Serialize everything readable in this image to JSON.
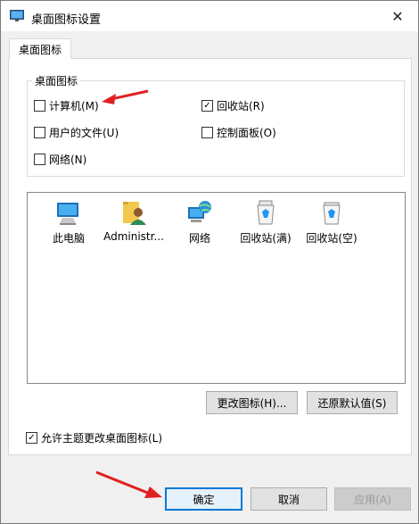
{
  "window": {
    "title": "桌面图标设置",
    "close_glyph": "✕"
  },
  "tab": {
    "label": "桌面图标"
  },
  "desktop_icons_group": {
    "legend": "桌面图标",
    "options": [
      {
        "label": "计算机(M)",
        "checked": false
      },
      {
        "label": "回收站(R)",
        "checked": true
      },
      {
        "label": "用户的文件(U)",
        "checked": false
      },
      {
        "label": "控制面板(O)",
        "checked": false
      },
      {
        "label": "网络(N)",
        "checked": false
      }
    ]
  },
  "icon_list": [
    {
      "label": "此电脑",
      "icon": "computer-icon"
    },
    {
      "label": "Administr...",
      "icon": "user-folder-icon"
    },
    {
      "label": "网络",
      "icon": "network-icon"
    },
    {
      "label": "回收站(满)",
      "icon": "recycle-bin-full-icon"
    },
    {
      "label": "回收站(空)",
      "icon": "recycle-bin-empty-icon"
    }
  ],
  "buttons": {
    "change_icon": "更改图标(H)...",
    "restore_default": "还原默认值(S)",
    "ok": "确定",
    "cancel": "取消",
    "apply": "应用(A)"
  },
  "allow_themes": {
    "label": "允许主题更改桌面图标(L)",
    "checked": true
  },
  "colors": {
    "accent": "#0078d7",
    "annotation_arrow": "#e02020"
  }
}
